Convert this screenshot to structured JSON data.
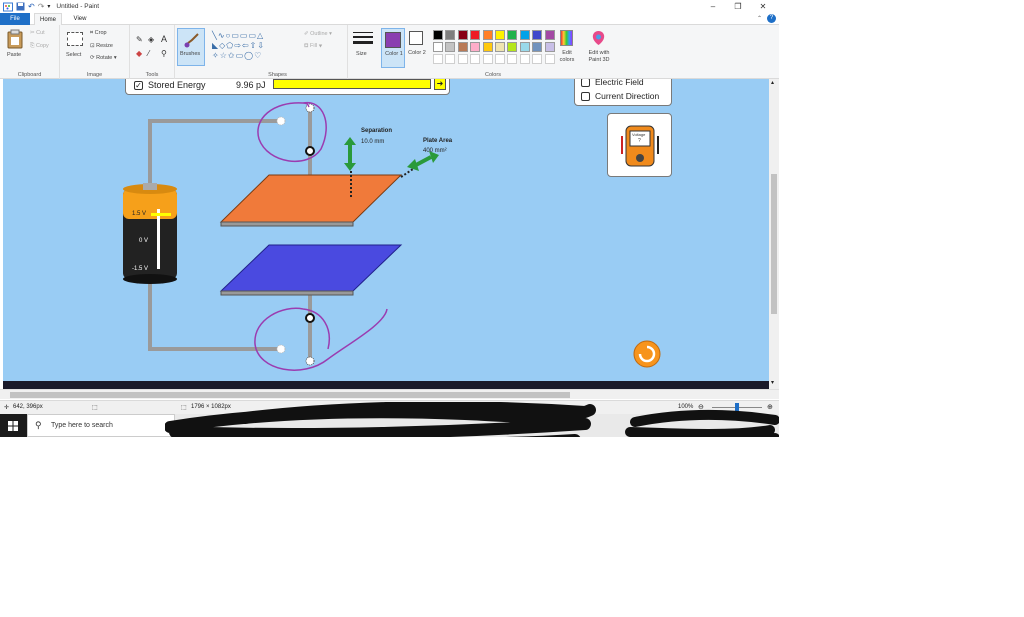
{
  "window": {
    "title": "Untitled - Paint",
    "controls": {
      "minimize": "–",
      "maximize": "❐",
      "close": "✕"
    },
    "help": "?"
  },
  "tabs": [
    {
      "label": "File"
    },
    {
      "label": "Home"
    },
    {
      "label": "View"
    }
  ],
  "ribbon": {
    "clipboard": {
      "label": "Clipboard",
      "paste": "Paste",
      "cut": "Cut",
      "copy": "Copy"
    },
    "image": {
      "label": "Image",
      "select": "Select",
      "crop": "Crop",
      "resize": "Resize",
      "rotate": "Rotate"
    },
    "tools": {
      "label": "Tools"
    },
    "brushes": {
      "label": "Brushes"
    },
    "shapes": {
      "label": "Shapes",
      "outline": "Outline",
      "fill": "Fill"
    },
    "size": {
      "label": "Size"
    },
    "color1": {
      "label": "Color 1"
    },
    "color2": {
      "label": "Color 2"
    },
    "colors": {
      "label": "Colors"
    },
    "edit_colors": {
      "label": "Edit colors"
    },
    "edit_paint3d": {
      "label": "Edit with Paint 3D"
    },
    "palette": {
      "row1": [
        "#000000",
        "#7f7f7f",
        "#880015",
        "#ed1c24",
        "#ff7f27",
        "#fff200",
        "#22b14c",
        "#00a2e8",
        "#3f48cc",
        "#a349a4"
      ],
      "row2": [
        "#ffffff",
        "#c3c3c3",
        "#b97a57",
        "#ffaec9",
        "#ffc90e",
        "#efe4b0",
        "#b5e61d",
        "#99d9ea",
        "#7092be",
        "#c8bfe7"
      ],
      "row3": [
        "#ffffff",
        "#ffffff",
        "#ffffff",
        "#ffffff",
        "#ffffff",
        "#ffffff",
        "#ffffff",
        "#ffffff",
        "#ffffff",
        "#ffffff"
      ]
    },
    "color1_value": "#8a3fb0",
    "color2_value": "#ffffff"
  },
  "sim": {
    "stored_energy_label": "Stored Energy",
    "stored_energy_value": "9.96 pJ",
    "electric_field_label": "Electric Field",
    "current_direction_label": "Current Direction",
    "separation_label": "Separation",
    "separation_value": "10.0 mm",
    "plate_area_label": "Plate Area",
    "plate_area_value": "400 mm²",
    "battery_top": "1.5 V",
    "battery_mid": "0 V",
    "battery_bot": "-1.5 V",
    "voltmeter_label": "Voltage",
    "voltmeter_value": "?"
  },
  "status": {
    "cursor": "642, 396px",
    "canvas_size": "1796 × 1082px",
    "zoom": "100%"
  },
  "taskbar": {
    "search_placeholder": "Type here to search"
  },
  "colors": {
    "accent": "#1e6fc7",
    "canvas_bg": "#99ccf4",
    "annotation": "#9b3cb0"
  }
}
